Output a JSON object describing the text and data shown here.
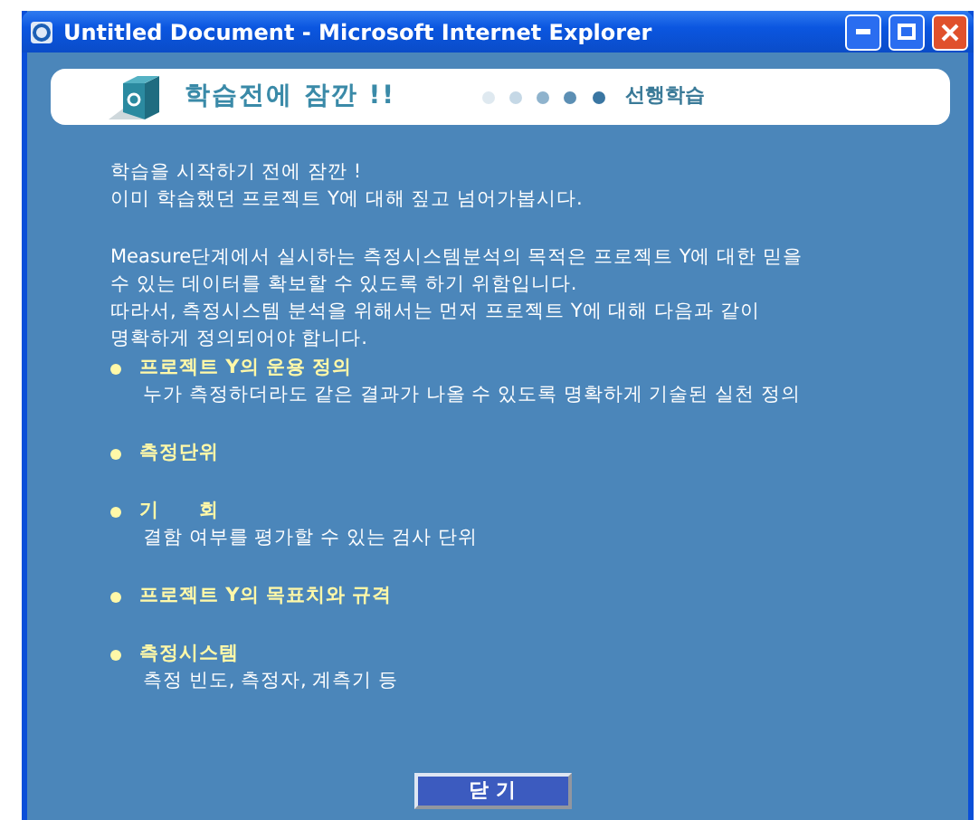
{
  "window": {
    "title": "Untitled Document - Microsoft Internet Explorer"
  },
  "header": {
    "title": "학습전에 잠깐 !!",
    "section": "선행학습"
  },
  "paragraphs": [
    "학습을 시작하기 전에 잠깐 !\n이미 학습했던 프로젝트 Y에 대해 짚고 넘어가봅시다.",
    "Measure단계에서 실시하는 측정시스템분석의 목적은 프로젝트 Y에 대한 믿을\n수 있는 데이터를 확보할 수 있도록 하기 위함입니다.\n따라서, 측정시스템 분석을 위해서는 먼저 프로젝트 Y에 대해 다음과 같이\n명확하게 정의되어야 합니다."
  ],
  "items": [
    {
      "title": "프로젝트 Y의 운용 정의",
      "description": "누가 측정하더라도 같은 결과가 나올 수 있도록 명확하게 기술된 실천 정의"
    },
    {
      "title": "측정단위"
    },
    {
      "title": "기      회",
      "description": "결함 여부를 평가할 수 있는 검사 단위"
    },
    {
      "title": "프로젝트 Y의 목표치와 규격"
    },
    {
      "title": "측정시스템",
      "description": "측정 빈도, 측정자, 계측기 등"
    }
  ],
  "close_button": "닫 기"
}
